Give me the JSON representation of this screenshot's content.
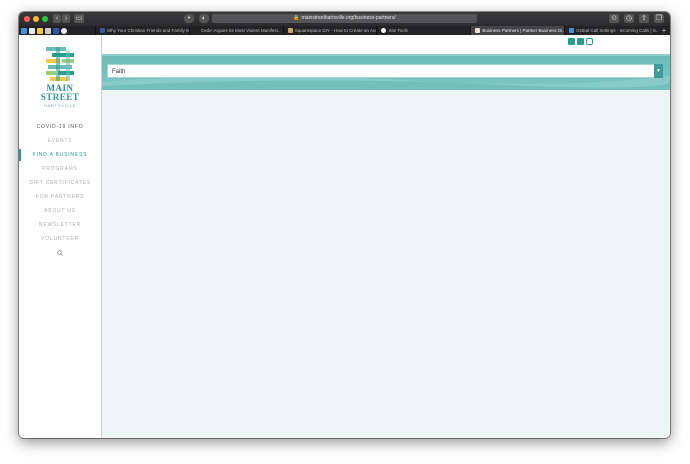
{
  "browser": {
    "url": "mainstreethartsville.org/business-partners/",
    "tabs": [
      {
        "label": "Why Your Christian Friends and Family M...",
        "icon_color": "#3b5998",
        "active": false
      },
      {
        "label": "Cede' Argues Its Most Violent Manifest...",
        "icon_color": "#222222",
        "active": false
      },
      {
        "label": "Squarespace DIY - How to Create an Acc...",
        "icon_color": "#c9a86b",
        "active": false
      },
      {
        "label": "Site Tools",
        "icon_color": "#ffffff",
        "active": false
      },
      {
        "label": "Business Partners | Partner Business Di...",
        "icon_color": "#e9e3d4",
        "active": true
      },
      {
        "label": "Global Call Settings - Incoming Calls | S...",
        "icon_color": "#4a90d9",
        "active": false
      }
    ]
  },
  "site": {
    "logo": {
      "line1": "MAIN",
      "line2": "STREET",
      "line3": "HARTSVILLE"
    },
    "nav": [
      {
        "label": "COVID-19 INFO",
        "state": "strong"
      },
      {
        "label": "EVENTS",
        "state": "normal"
      },
      {
        "label": "FIND A BUSINESS",
        "state": "active"
      },
      {
        "label": "PROGRAMS",
        "state": "normal"
      },
      {
        "label": "GIFT CERTIFICATES",
        "state": "normal"
      },
      {
        "label": "FOR PARTNERS",
        "state": "normal"
      },
      {
        "label": "ABOUT US",
        "state": "normal"
      },
      {
        "label": "NEWSLETTER",
        "state": "normal"
      },
      {
        "label": "VOLUNTEER",
        "state": "normal"
      }
    ],
    "social": [
      "facebook-icon",
      "twitter-icon",
      "instagram-icon"
    ],
    "filter": {
      "selected": "Faith"
    },
    "colors": {
      "accent": "#2a9d8f",
      "band": "#6cbcb8",
      "background": "#edf6f5"
    }
  }
}
